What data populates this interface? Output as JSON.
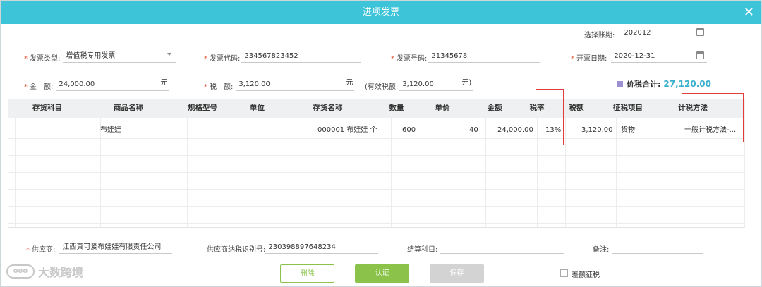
{
  "window": {
    "title": "进项发票"
  },
  "header": {
    "period_label": "选择账期:",
    "period_value": "202012",
    "invoice_type_label": "发票类型:",
    "invoice_type_value": "增值税专用发票",
    "invoice_code_label": "发票代码:",
    "invoice_code_value": "234567823452",
    "invoice_number_label": "发票号码:",
    "invoice_number_value": "21345678",
    "invoice_date_label": "开票日期:",
    "invoice_date_value": "2020-12-31",
    "amount_label": "金　额:",
    "amount_value": "24,000.00",
    "amount_unit": "元",
    "tax_label": "税　额:",
    "tax_value": "3,120.00",
    "tax_unit": "元",
    "valid_tax_label": "(有效税额:",
    "valid_tax_value": "3,120.00",
    "valid_tax_unit": "元)",
    "total_label": "价税合计:",
    "total_value": "27,120.00"
  },
  "table": {
    "columns": [
      "存货科目",
      "商品名称",
      "规格型号",
      "单位",
      "存货名称",
      "数量",
      "单价",
      "金额",
      "税率",
      "税额",
      "征税项目",
      "计税方法"
    ],
    "rows": [
      {
        "item": "",
        "product": "布娃娃",
        "spec": "",
        "unit": "",
        "inventory": "000001 布娃娃 个",
        "qty": "600",
        "price": "40",
        "amount": "24,000.00",
        "rate": "13%",
        "tax": "3,120.00",
        "tax_item": "货物",
        "method": "一般计税方法-..."
      }
    ]
  },
  "footer": {
    "supplier_label": "供应商:",
    "supplier_value": "江西真可爱布娃娃有限责任公司",
    "supplier_tax_id_label": "供应商纳税识别号:",
    "supplier_tax_id_value": "230398897648234",
    "settle_label": "结算科目:",
    "settle_value": "",
    "remark_label": "备注:",
    "remark_value": ""
  },
  "buttons": {
    "delete": "删除",
    "confirm": "认证",
    "save": "保存"
  },
  "checkbox": {
    "label": "差额征税"
  },
  "watermark": {
    "logo": "ooo",
    "text": "大数跨境"
  },
  "colors": {
    "title_bar": "#3ec4d8",
    "accent_green": "#8bc34a",
    "total": "#39b0cc",
    "required": "#e05a3b",
    "highlight_box": "#e23b3b"
  }
}
